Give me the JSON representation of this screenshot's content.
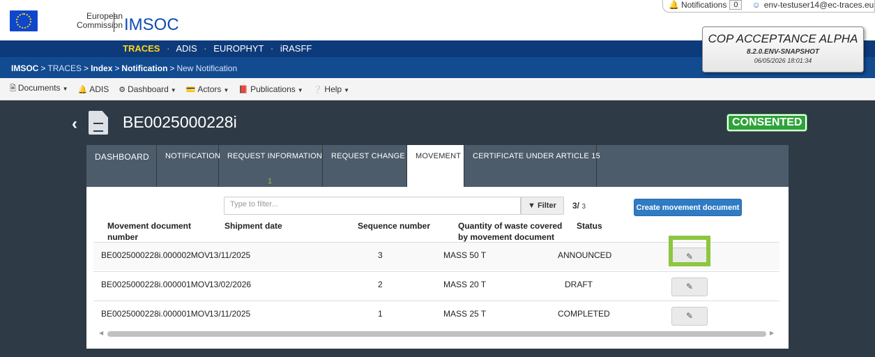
{
  "header": {
    "ec_name_line1": "European",
    "ec_name_line2": "Commission",
    "app_title": "IMSOC",
    "notifications_label": "Notifications",
    "notifications_count": "0",
    "user": "env-testuser14@ec-traces.eu"
  },
  "apps_nav": {
    "active": "TRACES",
    "items": [
      "ADIS",
      "EUROPHYT",
      "iRASFF"
    ]
  },
  "breadcrumb": {
    "items": [
      "IMSOC",
      "TRACES",
      "Index",
      "Notification",
      "New Notification"
    ]
  },
  "environment": {
    "title": "COP ACCEPTANCE ALPHA",
    "version": "8.2.0.ENV-SNAPSHOT",
    "datetime": "06/05/2026 18:01:34"
  },
  "menu": {
    "documents": "Documents",
    "adis": "ADIS",
    "dashboard": "Dashboard",
    "actors": "Actors",
    "publications": "Publications",
    "help": "Help"
  },
  "notification": {
    "id": "BE0025000228i",
    "status": "CONSENTED"
  },
  "tabs": {
    "dashboard": "Dashboard",
    "notification": "Notification",
    "request_information": "Request information",
    "request_information_count": "1",
    "request_change": "Request change",
    "movement": "Movement",
    "certificate": "Certificate under Article 15"
  },
  "movement": {
    "filter_placeholder": "Type to filter...",
    "filter_button": "Filter",
    "count_shown": "3/",
    "count_total": "3",
    "create_button": "Create movement document",
    "columns": {
      "doc_number": "Movement document number",
      "shipment_date": "Shipment date",
      "sequence": "Sequence number",
      "quantity": "Quantity of waste covered by movement document",
      "status": "Status"
    },
    "rows": [
      {
        "doc_number": "BE0025000228i.000002MOV",
        "shipment_date": "13/11/2025",
        "sequence": "3",
        "quantity": "MASS 50 T",
        "status": "ANNOUNCED"
      },
      {
        "doc_number": "BE0025000228i.000001MOV",
        "shipment_date": "13/02/2026",
        "sequence": "2",
        "quantity": "MASS 20 T",
        "status": "DRAFT"
      },
      {
        "doc_number": "BE0025000228i.000001MOV",
        "shipment_date": "13/11/2025",
        "sequence": "1",
        "quantity": "MASS 25 T",
        "status": "COMPLETED"
      }
    ]
  },
  "colors": {
    "nav_dark": "#0d3a7a",
    "nav_mid": "#134b91",
    "accent_yellow": "#ffd617",
    "consented_green": "#2fa33a",
    "highlight_green": "#8dc63f",
    "primary_button": "#2f7bc4"
  },
  "icons": {
    "bell": "bell-icon",
    "user": "user-icon",
    "back": "chevron-left-icon",
    "document": "document-icon",
    "filter": "filter-icon",
    "edit": "edit-icon"
  }
}
